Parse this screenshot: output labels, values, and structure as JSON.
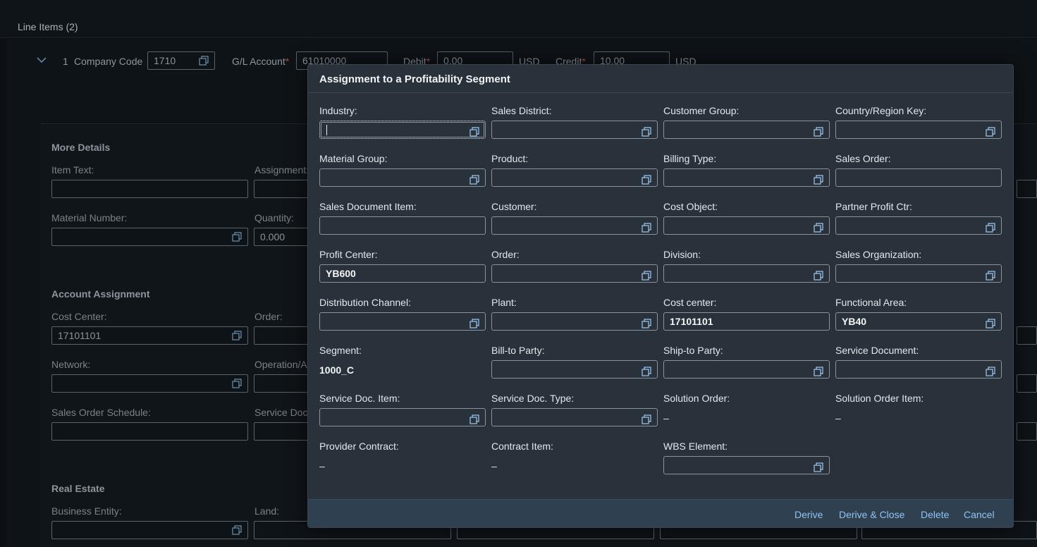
{
  "page": {
    "title": "Line Items (2)"
  },
  "line_item": {
    "number": "1",
    "company_code_label": "Company Code",
    "company_code_value": "1710",
    "gl_account_label": "G/L Account",
    "gl_account_required": "*",
    "gl_account_value": "61010000",
    "debit_label": "Debit",
    "debit_required": "*",
    "debit_value": "0.00",
    "debit_currency": "USD",
    "credit_label": "Credit",
    "credit_required": "*",
    "credit_value": "10.00",
    "credit_currency": "USD"
  },
  "details": {
    "more_details_title": "More Details",
    "item_text_label": "Item Text:",
    "assignment_label": "Assignment:",
    "material_number_label": "Material Number:",
    "quantity_label": "Quantity:",
    "quantity_value": "0.000",
    "account_assignment_title": "Account Assignment",
    "cost_center_label": "Cost Center:",
    "cost_center_value": "17101101",
    "order_label": "Order:",
    "network_label": "Network:",
    "operation_label": "Operation/Ac",
    "sales_order_schedule_label": "Sales Order Schedule:",
    "service_doc_label": "Service Doc",
    "real_estate_title": "Real Estate",
    "business_entity_label": "Business Entity:",
    "land_label": "Land:"
  },
  "dialog": {
    "title": "Assignment to a Profitability Segment",
    "fields": {
      "industry": {
        "label": "Industry:",
        "value": ""
      },
      "sales_district": {
        "label": "Sales District:",
        "value": ""
      },
      "customer_group": {
        "label": "Customer Group:",
        "value": ""
      },
      "country_region_key": {
        "label": "Country/Region Key:",
        "value": ""
      },
      "material_group": {
        "label": "Material Group:",
        "value": ""
      },
      "product": {
        "label": "Product:",
        "value": ""
      },
      "billing_type": {
        "label": "Billing Type:",
        "value": ""
      },
      "sales_order": {
        "label": "Sales Order:",
        "value": ""
      },
      "sales_document_item": {
        "label": "Sales Document Item:",
        "value": ""
      },
      "customer": {
        "label": "Customer:",
        "value": ""
      },
      "cost_object": {
        "label": "Cost Object:",
        "value": ""
      },
      "partner_profit_ctr": {
        "label": "Partner Profit Ctr:",
        "value": ""
      },
      "profit_center": {
        "label": "Profit Center:",
        "value": "YB600"
      },
      "order": {
        "label": "Order:",
        "value": ""
      },
      "division": {
        "label": "Division:",
        "value": ""
      },
      "sales_organization": {
        "label": "Sales Organization:",
        "value": ""
      },
      "distribution_channel": {
        "label": "Distribution Channel:",
        "value": ""
      },
      "plant": {
        "label": "Plant:",
        "value": ""
      },
      "cost_center": {
        "label": "Cost center:",
        "value": "17101101"
      },
      "functional_area": {
        "label": "Functional Area:",
        "value": "YB40"
      },
      "segment": {
        "label": "Segment:",
        "value": "1000_C"
      },
      "bill_to_party": {
        "label": "Bill-to Party:",
        "value": ""
      },
      "ship_to_party": {
        "label": "Ship-to Party:",
        "value": ""
      },
      "service_document": {
        "label": "Service Document:",
        "value": ""
      },
      "service_doc_item": {
        "label": "Service Doc. Item:",
        "value": ""
      },
      "service_doc_type": {
        "label": "Service Doc. Type:",
        "value": ""
      },
      "solution_order": {
        "label": "Solution Order:",
        "value": "–"
      },
      "solution_order_item": {
        "label": "Solution Order Item:",
        "value": "–"
      },
      "provider_contract": {
        "label": "Provider Contract:",
        "value": "–"
      },
      "contract_item": {
        "label": "Contract Item:",
        "value": "–"
      },
      "wbs_element": {
        "label": "WBS Element:",
        "value": ""
      }
    },
    "buttons": {
      "derive": "Derive",
      "derive_close": "Derive & Close",
      "delete": "Delete",
      "cancel": "Cancel"
    }
  },
  "colors": {
    "link": "#8fc3f4",
    "dialog_bg": "#29313a",
    "footer_bg": "#2f4050",
    "required": "#bb4444"
  },
  "icons": {
    "value_help": "value-help-icon",
    "expand": "chevron-down-icon"
  }
}
